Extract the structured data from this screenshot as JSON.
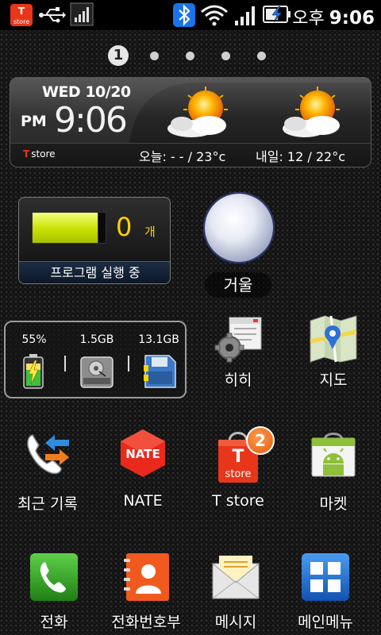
{
  "status_bar": {
    "ampm": "오후",
    "time": "9:06",
    "icons": [
      "tstore-icon",
      "usb-icon",
      "signal-bars-icon",
      "bluetooth-icon",
      "wifi-icon",
      "cell-signal-icon",
      "battery-charging-icon"
    ],
    "tstore_label": "store"
  },
  "page_indicator": {
    "current": "1",
    "total": 5
  },
  "weather_widget": {
    "date": "WED 10/20",
    "ampm": "PM",
    "time": "9:06",
    "brand": "store",
    "today": "오늘: - - / 23°c",
    "tomorrow": "내일: 12 / 22°c",
    "icons": [
      "sun-cloud-icon",
      "sun-cloud-icon"
    ]
  },
  "task_widget": {
    "count": "0",
    "unit": "개",
    "label": "프로그램 실행 중",
    "fill_fraction": 0.88
  },
  "mirror": {
    "label": "거울"
  },
  "storage_widget": {
    "battery": "55%",
    "internal": "1.5GB",
    "sd_card": "13.1GB"
  },
  "apps": {
    "hihi": "히히",
    "map": "지도",
    "recent_calls": "최근 기록",
    "nate": "NATE",
    "nate_logo": "NATE",
    "tstore": "T store",
    "tstore_icon_text": "store",
    "tstore_badge": "2",
    "market": "마켓"
  },
  "dock": {
    "phone": "전화",
    "contacts": "전화번호부",
    "messages": "메시지",
    "menu": "메인메뉴"
  },
  "colors": {
    "accent_yellow": "#ffd200",
    "nate_red": "#e8291c",
    "tstore_red": "#e8361b",
    "phone_green": "#2d9a1e",
    "contacts_orange": "#f05a1e",
    "menu_blue": "#1d6fd6",
    "bluetooth_blue": "#1a73e8"
  }
}
